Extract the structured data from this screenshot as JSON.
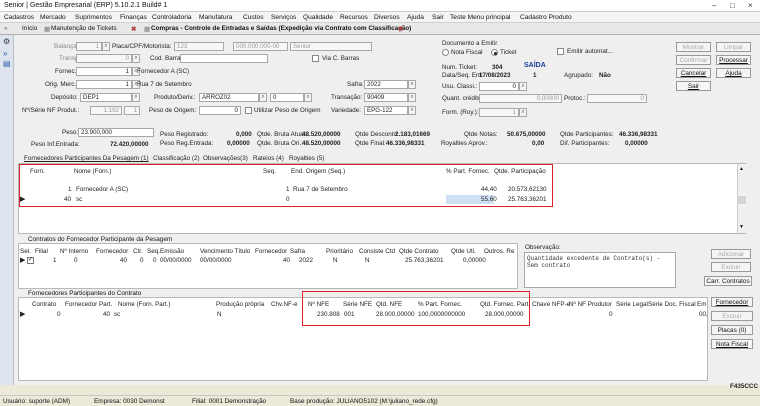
{
  "app": {
    "title": "Senior | Gestão Empresarial (ERP) 5.10.2.1 Build# 1"
  },
  "menu": [
    "Cadastros",
    "Mercado",
    "Suprimentos",
    "Finanças",
    "Controladoria",
    "Manufatura",
    "Custos",
    "Serviços",
    "Qualidade",
    "Recursos",
    "Diversos",
    "Ajuda",
    "Sair",
    "Teste Menu principal",
    "Cadastro Produto"
  ],
  "tabs": [
    {
      "label": "Início"
    },
    {
      "label": "Manutenção de Tickets"
    },
    {
      "label": "Compras - Controle de Entradas e Saídas (Expedição via Contrato com Classificação)"
    }
  ],
  "form": {
    "balanca_label": "Balança:",
    "balanca_value": "1",
    "placa_label": "Placa/CPF/Motorista:",
    "placa_value": "123",
    "cpf_value": "000.000.000-00",
    "motorista_value": "Senior",
    "transp_label": "Transp.:",
    "transp_value": "0",
    "cod_barras_label": "Cod. Barras:",
    "via_barras_label": "Via C. Barras",
    "fornec_label": "Fornec.:",
    "fornec_value": "1",
    "fornec_desc": "Fornecedor A (SC)",
    "orig_label": "Orig. Merc.:",
    "orig_value": "1",
    "orig_desc": "Rua 7 de Setembro",
    "safra_label": "Safra:",
    "safra_value": "2022",
    "deposito_label": "Depósito:",
    "deposito_value": "DEP1",
    "produto_label": "Produto/Deriv.:",
    "produto_value": "ARROZ02",
    "deriv_value": "0",
    "transacao_label": "Transação:",
    "transacao_value": "90409",
    "nfserie_label": "Nº/Série NF Produt.:",
    "nf_value": "1.192",
    "serie_value": "1",
    "peso_origem_label": "Peso de Origem:",
    "peso_origem_value": "0",
    "util_peso_label": "Utilizar Peso de Origem",
    "variedade_label": "Variedade:",
    "variedade_value": "EPG-122"
  },
  "doc": {
    "title": "Documento a Emitir",
    "nota_fiscal": "Nota Fiscal",
    "ticket": "Ticket",
    "emitir_auto": "Emitir automat...",
    "num_ticket_label": "Num. Ticket:",
    "num_ticket": "304",
    "status": "SAÍDA",
    "data_label": "Data/Seq. Ent:",
    "data_value": "17/08/2023",
    "seq_value": "1",
    "agrupado_label": "Agrupado:",
    "agrupado_value": "Não",
    "usu_label": "Usu. Classi.:",
    "usu_value": "0",
    "quant_label": "Quant. crédito:",
    "quant_value": "0,00000",
    "protoc_label": "Protoc.:",
    "protoc_value": "0",
    "form_label": "Form. (Roy.):",
    "form_value": "1"
  },
  "buttons": {
    "mostrar": "Mostrar",
    "limpar": "Limpar",
    "confirmar": "Confirmar",
    "processar": "Processar",
    "cancelar": "Cancelar",
    "ajuda": "Ajuda",
    "sair": "Sair"
  },
  "summary": {
    "peso_label": "Peso:",
    "peso_value": "23.900,000",
    "peso_inf_label": "Peso Inf.Entrada:",
    "peso_inf_value": "72.420,00000",
    "peso_reg_label": "Peso Registrado:",
    "peso_reg_value": "0,000",
    "peso_reg_ent_label": "Peso Reg.Entrada:",
    "peso_reg_ent_value": "0,00000",
    "bruta_atual_label": "Qtde. Bruta Atual:",
    "bruta_atual_value": "48.520,00000",
    "bruta_ori_label": "Qtde. Bruta Ori.:",
    "bruta_ori_value": "48.520,00000",
    "desconto_label": "Qtde Desconto:",
    "desconto_value": "2.183,01669",
    "final_label": "Qtde Final:",
    "final_value": "46.336,98331",
    "notas_label": "Qtde Notas:",
    "notas_value": "50.675,00000",
    "royalties_label": "Royalties Aprov.:",
    "royalties_value": "0,00",
    "participantes_label": "Qtde Participantes:",
    "participantes_value": "46.336,98331",
    "dif_label": "Dif. Participantes:",
    "dif_value": "0,00000"
  },
  "section_tabs": [
    "Fornecedores Participantes Da Pesagem (1)",
    "Classificação (2)",
    "Observações(3)",
    "Rateios (4)",
    "Royalties (5)"
  ],
  "participants": {
    "columns": [
      "Forn.",
      "Nome (Forn.)",
      "Seq.",
      "End. Origem (Seq.)",
      "% Part. Fornec.",
      "Qtde. Participação"
    ],
    "rows": [
      {
        "forn": "1",
        "nome": "Fornecedor A (SC)",
        "seq": "1",
        "end": "Rua 7 de Setembro",
        "perc": "44,40",
        "qtde": "20.573,62130"
      },
      {
        "forn": "40",
        "nome": "sc",
        "seq": "0",
        "end": "",
        "perc": "55,60",
        "qtde": "25.763,36201"
      }
    ]
  },
  "contracts": {
    "title": "Contratos do Fornecedor Participante da Pesagem",
    "columns": [
      "Sel.",
      "Filial",
      "Nº Interno",
      "Fornecedor",
      "Ctr.",
      "Seq.",
      "Emissão",
      "Vencimento Título",
      "Fornecedor",
      "Safra",
      "Prioritário",
      "Consiste Ctd",
      "Qtde Contrato",
      "Qtde Uti.",
      "Outros. Re"
    ],
    "row": {
      "filial": "1",
      "interno": "0",
      "fornecedor": "40",
      "ctr": "0",
      "seq": "0",
      "emissao": "00/00/0000",
      "venc": "00/00/0000",
      "forn2": "40",
      "safra": "2022",
      "prior": "N",
      "consiste": "N",
      "qtde": "25.763,36201",
      "uti": "0,00000",
      "outros": ""
    },
    "obs_label": "Observação:",
    "obs_text": "Quantidade excedente de Contrato(s) - Sem contrato",
    "btn_adicionar": "Adicionar",
    "btn_excluir": "Excluir",
    "btn_carr": "Carr. Contratos"
  },
  "vendor_contracts": {
    "title": "Fornecedores Participantes do Contrato",
    "columns": [
      "Contrato",
      "Fornecedor Part.",
      "Nome (Forn. Part.)",
      "Produção própria",
      "Chv.NF-e",
      "Nº NFE",
      "Série NFE",
      "Qtd. NFE",
      "% Part. Fornec.",
      "Qtd. Fornec. Part.",
      "Chave NFP-e",
      "Nº NF Produtor",
      "Série Legal",
      "Série Doc. Fiscal",
      "Em"
    ],
    "row": {
      "contrato": "0",
      "forn": "40",
      "nome": "sc",
      "producao": "N",
      "chv": "",
      "nfe": "230.808",
      "serie": "001",
      "qtd": "28.000,00000",
      "perc": "100,0000000000",
      "qtd_part": "28.000,00000",
      "chave_nfp": "",
      "nf_prod": "0",
      "serie_legal": "",
      "serie_doc": "",
      "em": "00,"
    },
    "btn_fornecedor": "Fornecedor",
    "btn_excluir": "Excluir",
    "btn_placas": "Placas (0)",
    "btn_nota": "Nota Fiscal"
  },
  "footer_code": "F435CCC",
  "status": {
    "usuario": "Usuário: suporte (ADM)",
    "empresa": "Empresa: 0030 Demonst",
    "filial": "Filial: 0001 Demonstração",
    "base": "Base produção: JULIANO5102 (M:\\juliano_rede.cfg)"
  }
}
